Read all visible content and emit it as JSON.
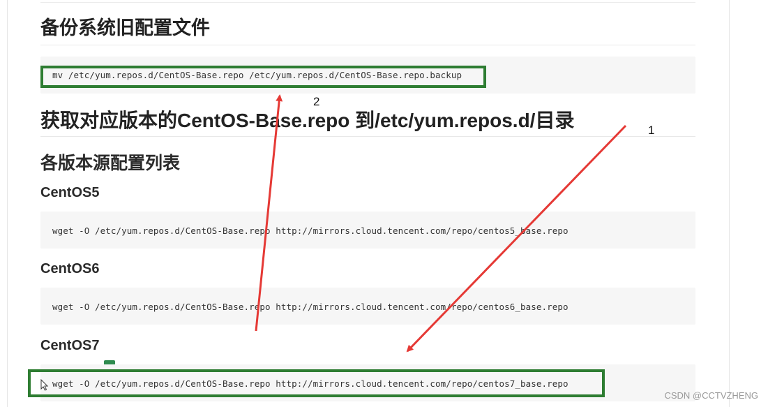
{
  "article": {
    "heading_backup": "备份系统旧配置文件",
    "code_backup": "mv /etc/yum.repos.d/CentOS-Base.repo /etc/yum.repos.d/CentOS-Base.repo.backup",
    "heading_fetch": "获取对应版本的CentOS-Base.repo 到/etc/yum.repos.d/目录",
    "heading_list": "各版本源配置列表",
    "sections": [
      {
        "title": "CentOS5",
        "code": "wget -O /etc/yum.repos.d/CentOS-Base.repo http://mirrors.cloud.tencent.com/repo/centos5_base.repo"
      },
      {
        "title": "CentOS6",
        "code": "wget -O /etc/yum.repos.d/CentOS-Base.repo http://mirrors.cloud.tencent.com/repo/centos6_base.repo"
      },
      {
        "title": "CentOS7",
        "code": "wget -O /etc/yum.repos.d/CentOS-Base.repo http://mirrors.cloud.tencent.com/repo/centos7_base.repo"
      }
    ]
  },
  "annotations": {
    "label_1": "1",
    "label_2": "2",
    "highlight_color": "#2e7d32",
    "arrow_color": "#e53935"
  },
  "watermark": "CSDN @CCTVZHENG",
  "icons": {
    "cursor": "mouse-pointer-icon",
    "tag": "green-tag-icon"
  }
}
